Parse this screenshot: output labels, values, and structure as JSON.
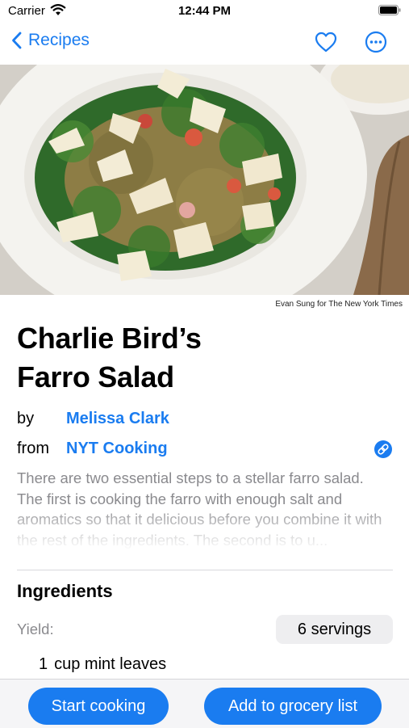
{
  "status_bar": {
    "carrier": "Carrier",
    "time": "12:44 PM"
  },
  "nav": {
    "back_label": "Recipes"
  },
  "hero": {
    "credit": "Evan Sung for The New York Times"
  },
  "recipe": {
    "title_line1": "Charlie Bird’s",
    "title_line2": "Farro Salad",
    "by_label": "by",
    "author": "Melissa Clark",
    "from_label": "from",
    "source": "NYT Cooking",
    "description": "There are two essential steps to a stellar farro salad. The first is cooking the farro with enough salt and aromatics so that it delicious before you combine it with the rest of the ingredients. The second is to u..."
  },
  "ingredients": {
    "heading": "Ingredients",
    "yield_label": "Yield:",
    "servings": "6 servings",
    "items": [
      {
        "qty": "1",
        "text": "cup mint leaves"
      }
    ]
  },
  "toolbar": {
    "start_label": "Start cooking",
    "grocery_label": "Add to grocery list"
  },
  "colors": {
    "accent": "#1a7cf0",
    "secondary_text": "#8a8a8e",
    "toolbar_bg": "#f5f5f7"
  }
}
